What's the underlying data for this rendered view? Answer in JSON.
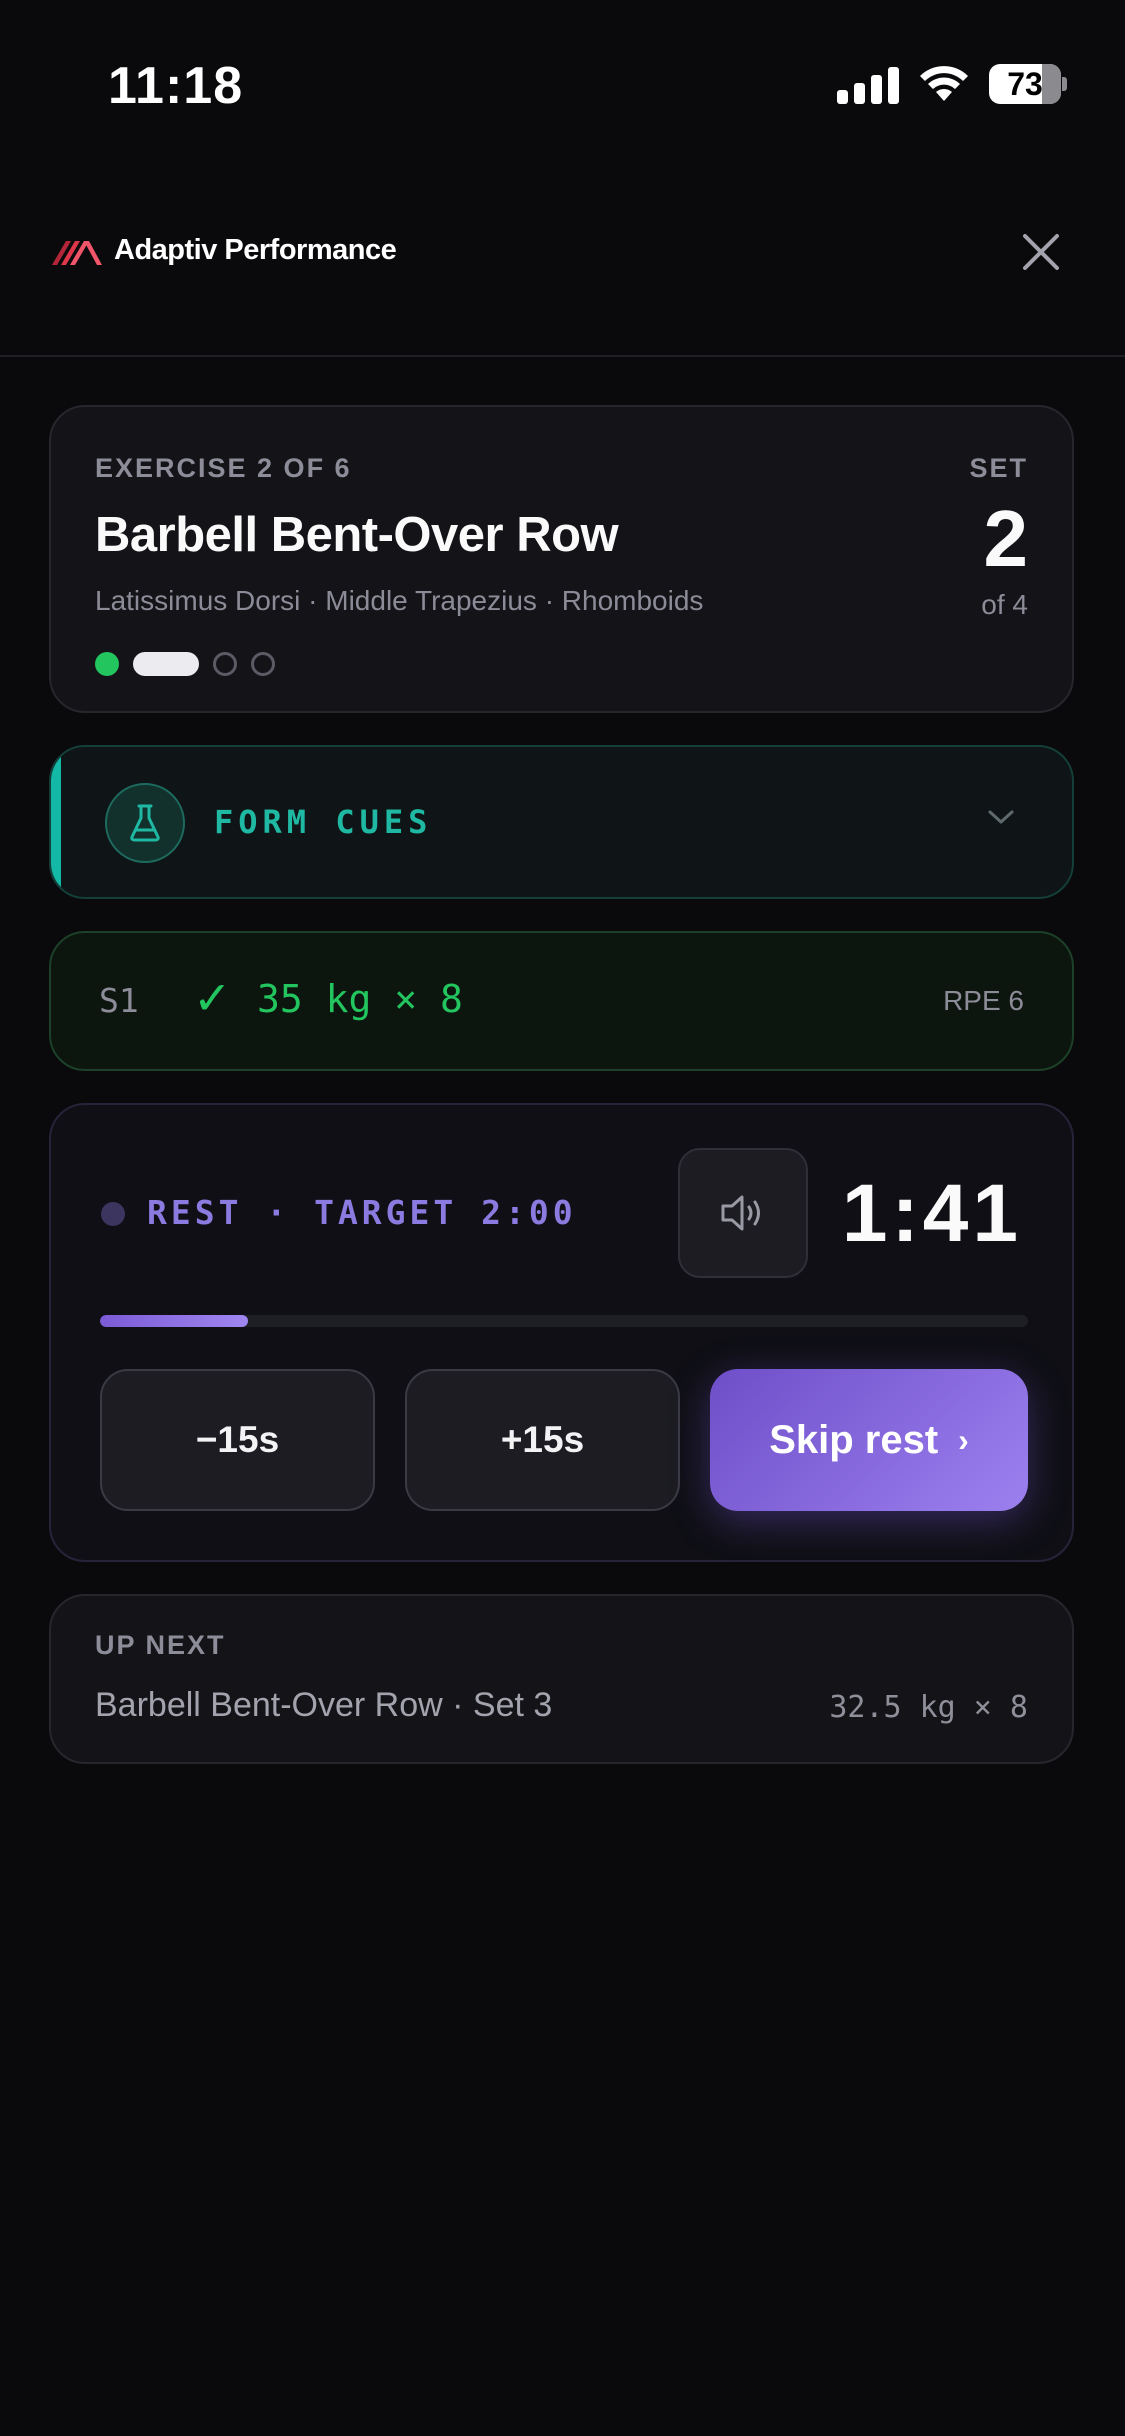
{
  "status_bar": {
    "time": "11:18",
    "battery_percent": "73",
    "icons": [
      "cellular-signal-icon",
      "wifi-icon",
      "battery-icon"
    ]
  },
  "header": {
    "brand_name": "Adaptiv Performance",
    "logo_icon": "chevron-stripes-logo-icon",
    "close_icon": "close-icon"
  },
  "exercise": {
    "counter": "EXERCISE 2 OF 6",
    "name": "Barbell Bent-Over Row",
    "muscles": "Latissimus Dorsi · Middle Trapezius · Rhomboids",
    "set_label": "SET",
    "set_number": "2",
    "set_of": "of 4",
    "set_progress": [
      "done",
      "current",
      "todo",
      "todo"
    ]
  },
  "form_cues": {
    "label": "FORM CUES",
    "icon": "flask-icon",
    "expand_icon": "chevron-down-icon",
    "accent_color": "#14b8a6"
  },
  "logged_set": {
    "set": "S1",
    "check": "✓",
    "value": "35 kg × 8",
    "rpe": "RPE 6",
    "color": "#22c55e"
  },
  "rest": {
    "label": "REST · TARGET 2:00",
    "timer": "1:41",
    "sound_icon": "speaker-icon",
    "progress_fraction": 0.16,
    "minus_label": "−15s",
    "plus_label": "+15s",
    "skip_label": "Skip rest",
    "skip_arrow": "›",
    "accent_color": "#8b7be0"
  },
  "up_next": {
    "label": "UP NEXT",
    "name": "Barbell Bent-Over Row · Set 3",
    "weight": "32.5 kg × 8"
  }
}
